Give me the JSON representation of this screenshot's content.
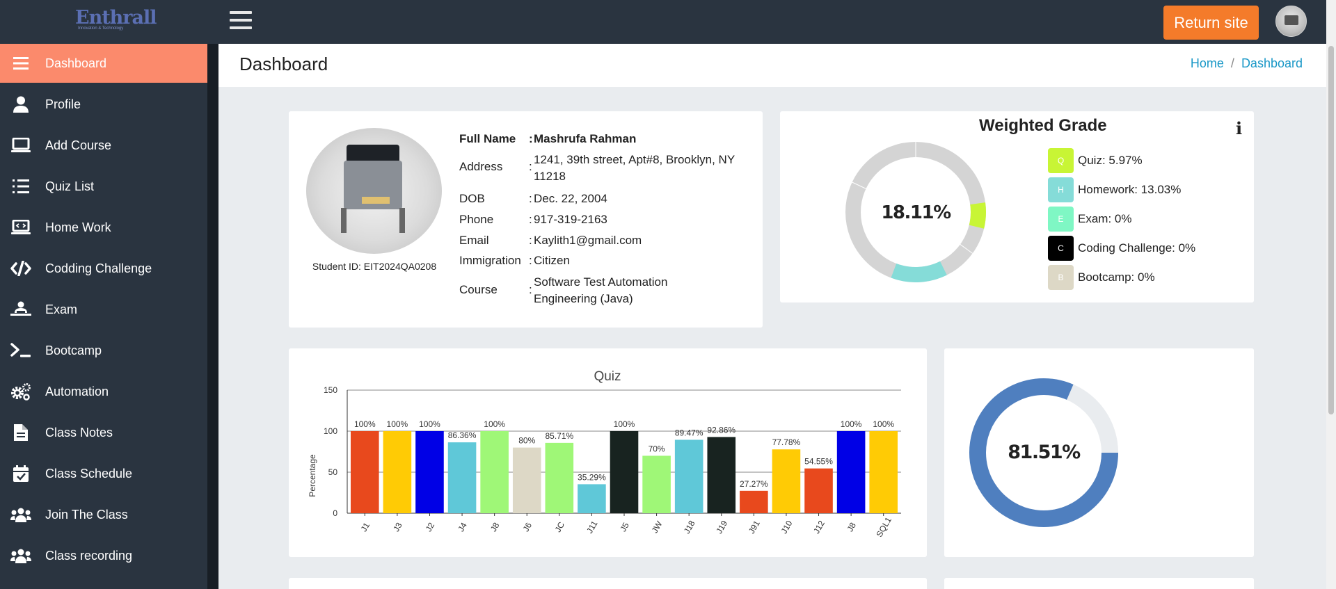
{
  "header": {
    "logo_text": "Enthrall",
    "logo_tagline": "Innovation & Technology",
    "return_label": "Return site"
  },
  "sidebar": {
    "items": [
      {
        "label": "Dashboard",
        "icon": "list-icon",
        "active": true
      },
      {
        "label": "Profile",
        "icon": "user-icon"
      },
      {
        "label": "Add Course",
        "icon": "laptop-icon"
      },
      {
        "label": "Quiz List",
        "icon": "list-ol-icon"
      },
      {
        "label": "Home Work",
        "icon": "laptop-code-icon"
      },
      {
        "label": "Codding Challenge",
        "icon": "code-icon"
      },
      {
        "label": "Exam",
        "icon": "user-exam-icon"
      },
      {
        "label": "Bootcamp",
        "icon": "terminal-icon"
      },
      {
        "label": "Automation",
        "icon": "cogs-icon"
      },
      {
        "label": "Class Notes",
        "icon": "file-icon"
      },
      {
        "label": "Class Schedule",
        "icon": "calendar-check-icon"
      },
      {
        "label": "Join The Class",
        "icon": "users-icon"
      },
      {
        "label": "Class recording",
        "icon": "users-icon"
      }
    ]
  },
  "page": {
    "title": "Dashboard",
    "breadcrumb": [
      "Home",
      "Dashboard"
    ]
  },
  "profile": {
    "student_id": "Student ID: EIT2024QA0208",
    "fields": [
      {
        "label": "Full Name",
        "value": "Mashrufa Rahman"
      },
      {
        "label": "Address",
        "value": "1241, 39th street, Apt#8, Brooklyn, NY 11218"
      },
      {
        "label": "DOB",
        "value": "Dec. 22, 2004"
      },
      {
        "label": "Phone",
        "value": "917-319-2163"
      },
      {
        "label": "Email",
        "value": "Kaylith1@gmail.com"
      },
      {
        "label": "Immigration",
        "value": "Citizen"
      },
      {
        "label": "Course",
        "value": "Software Test Automation Engineering (Java)"
      }
    ]
  },
  "weighted_grade": {
    "title": "Weighted Grade",
    "total": "18.11%",
    "legend": [
      {
        "letter": "Q",
        "label": "Quiz: 5.97%",
        "color": "#c8f535",
        "value": 5.97
      },
      {
        "letter": "H",
        "label": "Homework: 13.03%",
        "color": "#85dcd8",
        "value": 13.03
      },
      {
        "letter": "E",
        "label": "Exam: 0%",
        "color": "#7ff7c4",
        "value": 0
      },
      {
        "letter": "C",
        "label": "Coding Challenge: 0%",
        "color": "#000000",
        "value": 0
      },
      {
        "letter": "B",
        "label": "Bootcamp: 0%",
        "color": "#ddd8c6",
        "value": 0
      }
    ]
  },
  "chart_data": [
    {
      "type": "bar",
      "title": "Quiz",
      "ylabel": "Percentage",
      "ylim": [
        0,
        150
      ],
      "yticks": [
        0,
        50,
        100,
        150
      ],
      "categories": [
        "J1",
        "J3",
        "J2",
        "J4",
        "J8",
        "J6",
        "JC",
        "J11",
        "J5",
        "JW",
        "J18",
        "J19",
        "J91",
        "J10",
        "J12",
        "J8",
        "SQL1"
      ],
      "values": [
        100,
        100,
        100,
        86.36,
        100,
        80,
        85.71,
        35.29,
        100,
        70,
        89.47,
        92.86,
        27.27,
        77.78,
        54.55,
        100,
        100
      ],
      "labels": [
        "100%",
        "100%",
        "100%",
        "86.36%",
        "100%",
        "80%",
        "85.71%",
        "35.29%",
        "100%",
        "70%",
        "89.47%",
        "92.86%",
        "27.27%",
        "77.78%",
        "54.55%",
        "100%",
        "100%"
      ],
      "colors": [
        "#e8491d",
        "#ffcb05",
        "#0000e6",
        "#5fc8d8",
        "#9ff777",
        "#ddd8c6",
        "#9ff777",
        "#5fc8d8",
        "#182320",
        "#9ff777",
        "#5fc8d8",
        "#182320",
        "#e8491d",
        "#ffcb05",
        "#e8491d",
        "#0000e6",
        "#ffcb05"
      ],
      "grid": true
    },
    {
      "type": "pie",
      "donut": true,
      "center_label": "81.51%",
      "values": [
        81.51,
        18.49
      ],
      "colors": [
        "#4f7fbf",
        "#e9ecef"
      ]
    }
  ]
}
